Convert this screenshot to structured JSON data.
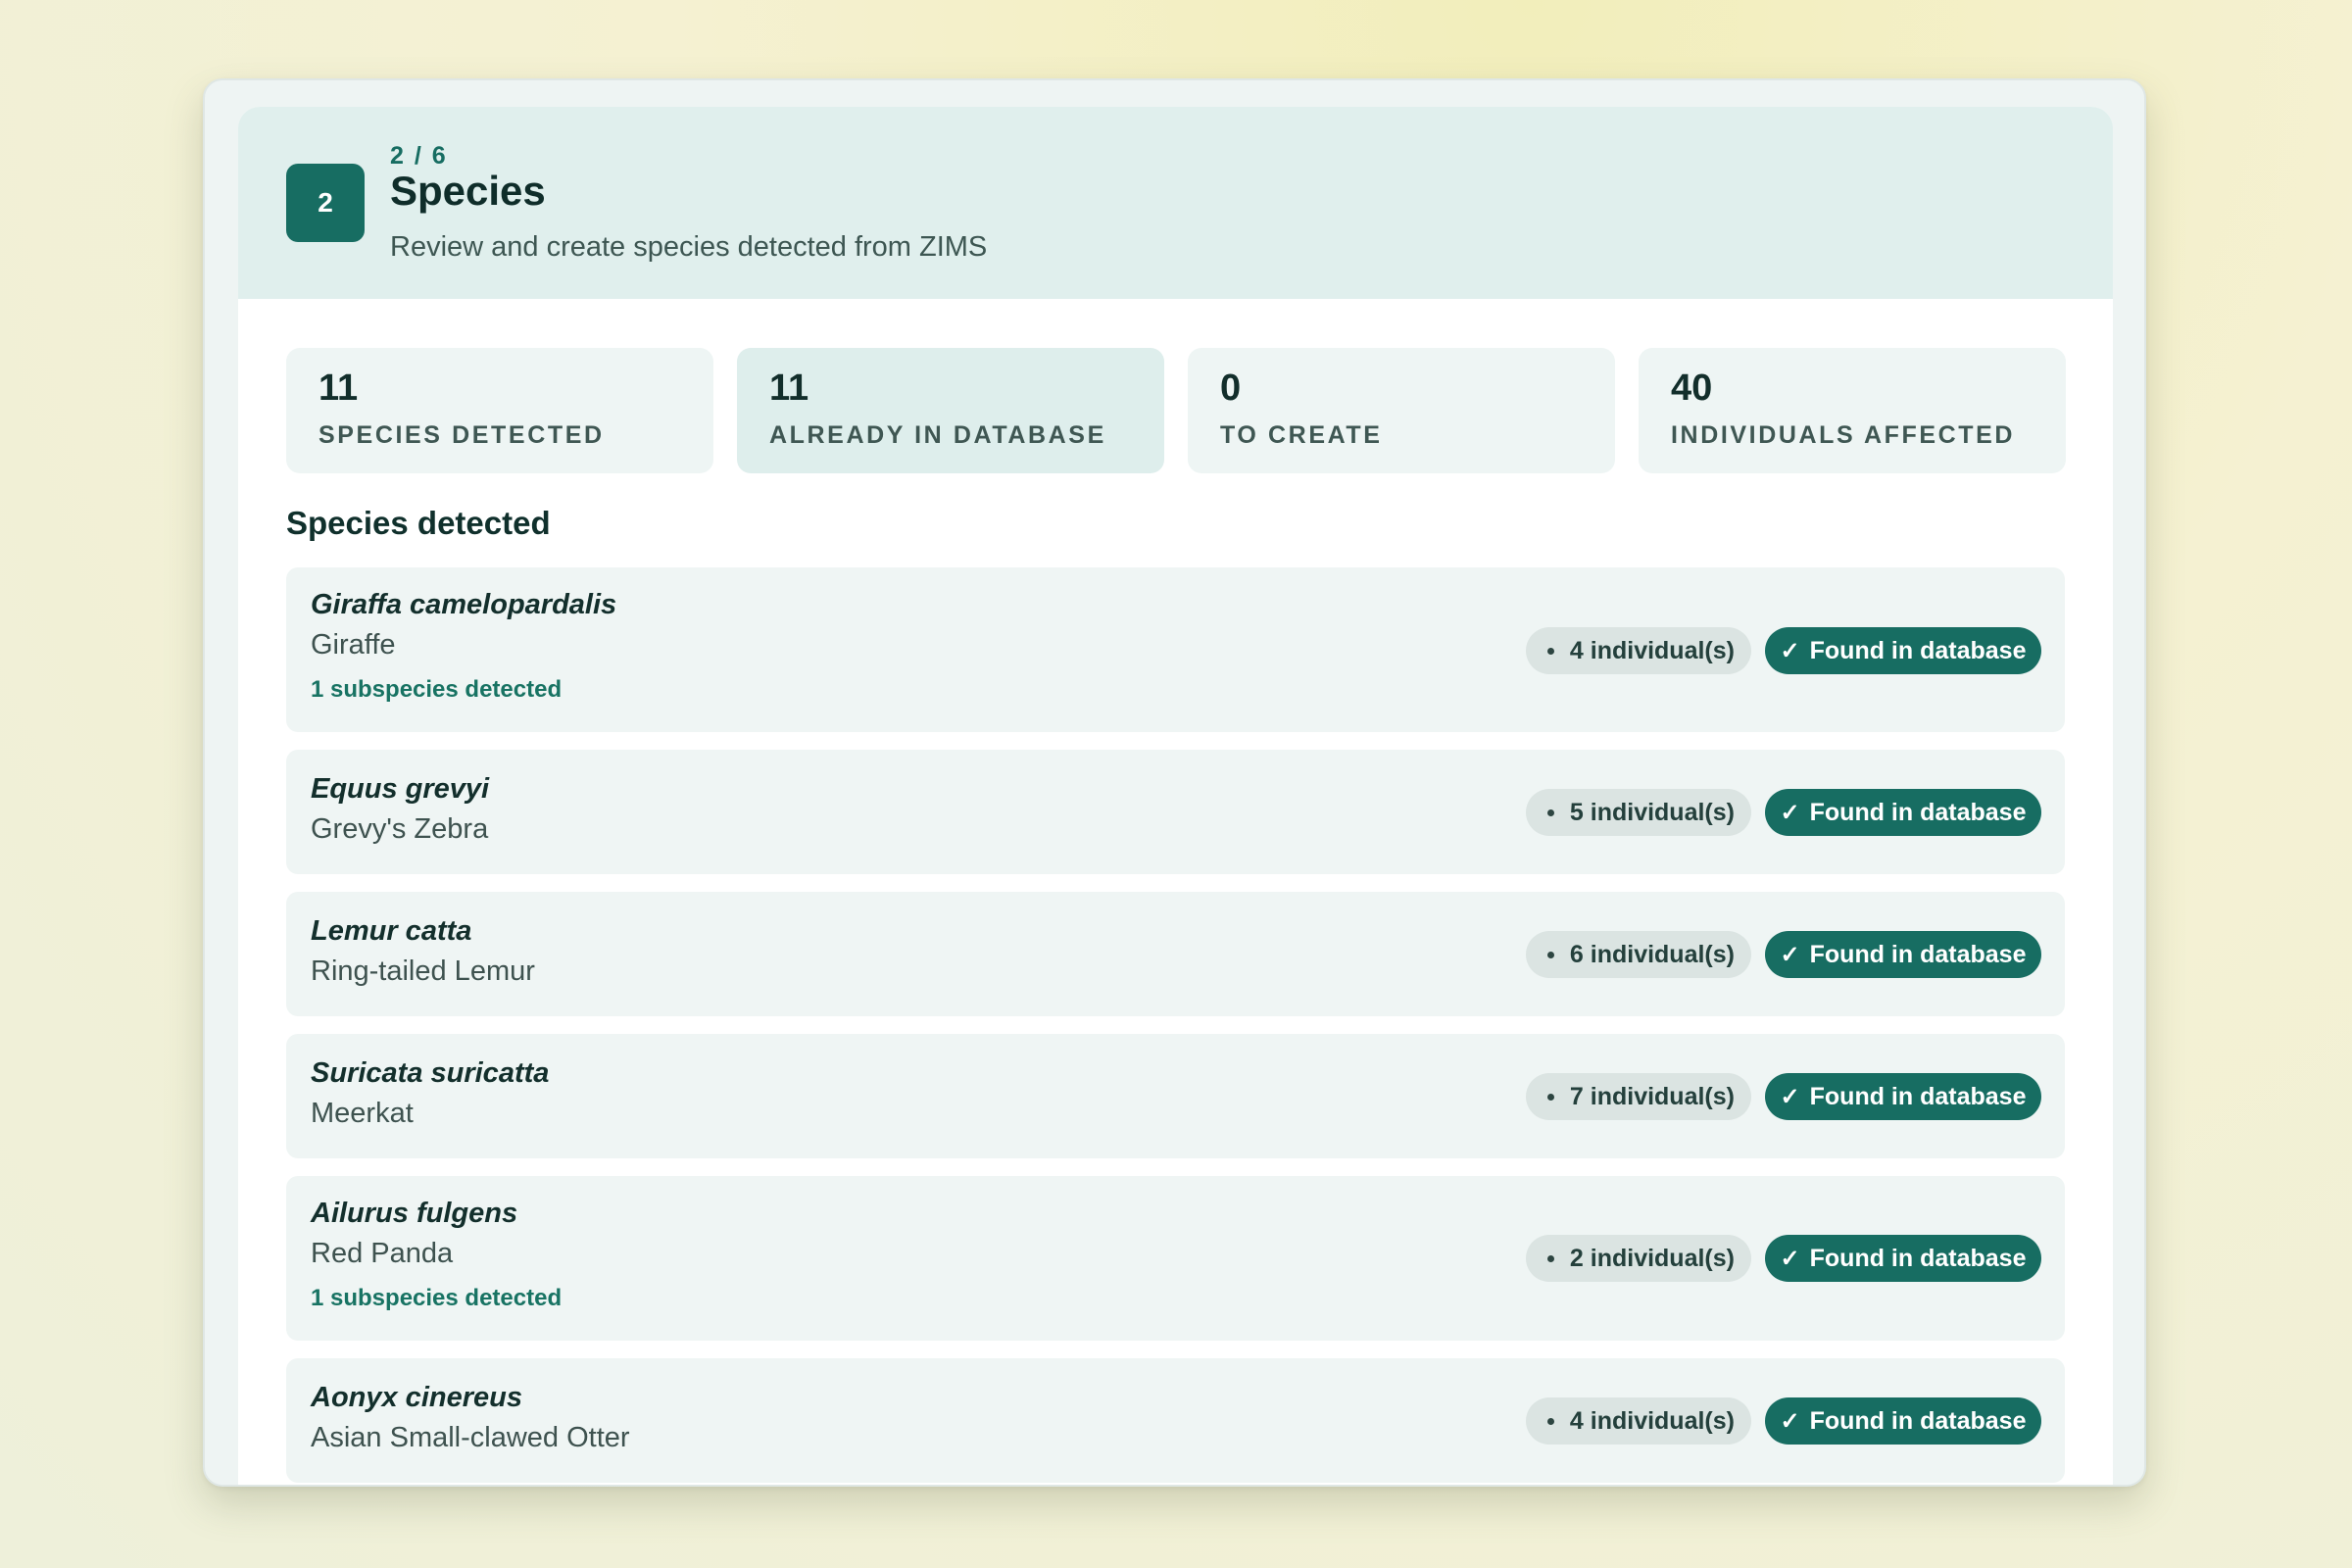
{
  "header": {
    "step_number": "2",
    "progress": "2 / 6",
    "title": "Species",
    "subtitle": "Review and create species detected from ZIMS"
  },
  "stats": [
    {
      "value": "11",
      "label": "SPECIES DETECTED"
    },
    {
      "value": "11",
      "label": "ALREADY IN DATABASE"
    },
    {
      "value": "0",
      "label": "TO CREATE"
    },
    {
      "value": "40",
      "label": "INDIVIDUALS AFFECTED"
    }
  ],
  "section": {
    "title": "Species detected"
  },
  "species": [
    {
      "scientific": "Giraffa camelopardalis",
      "common": "Giraffe",
      "subspecies": "1 subspecies detected",
      "count": "4 individual(s)",
      "status": "Found in database"
    },
    {
      "scientific": "Equus grevyi",
      "common": "Grevy's Zebra",
      "count": "5 individual(s)",
      "status": "Found in database"
    },
    {
      "scientific": "Lemur catta",
      "common": "Ring-tailed Lemur",
      "count": "6 individual(s)",
      "status": "Found in database"
    },
    {
      "scientific": "Suricata suricatta",
      "common": "Meerkat",
      "count": "7 individual(s)",
      "status": "Found in database"
    },
    {
      "scientific": "Ailurus fulgens",
      "common": "Red Panda",
      "subspecies": "1 subspecies detected",
      "count": "2 individual(s)",
      "status": "Found in database"
    },
    {
      "scientific": "Aonyx cinereus",
      "common": "Asian Small-clawed Otter",
      "count": "4 individual(s)",
      "status": "Found in database"
    }
  ],
  "icons": {
    "status": "checkmark-icon",
    "count": "bullet-dot-icon"
  },
  "colors": {
    "accent": "#176d62",
    "header_bg": "#e0efed",
    "row_bg": "#eff5f4"
  }
}
